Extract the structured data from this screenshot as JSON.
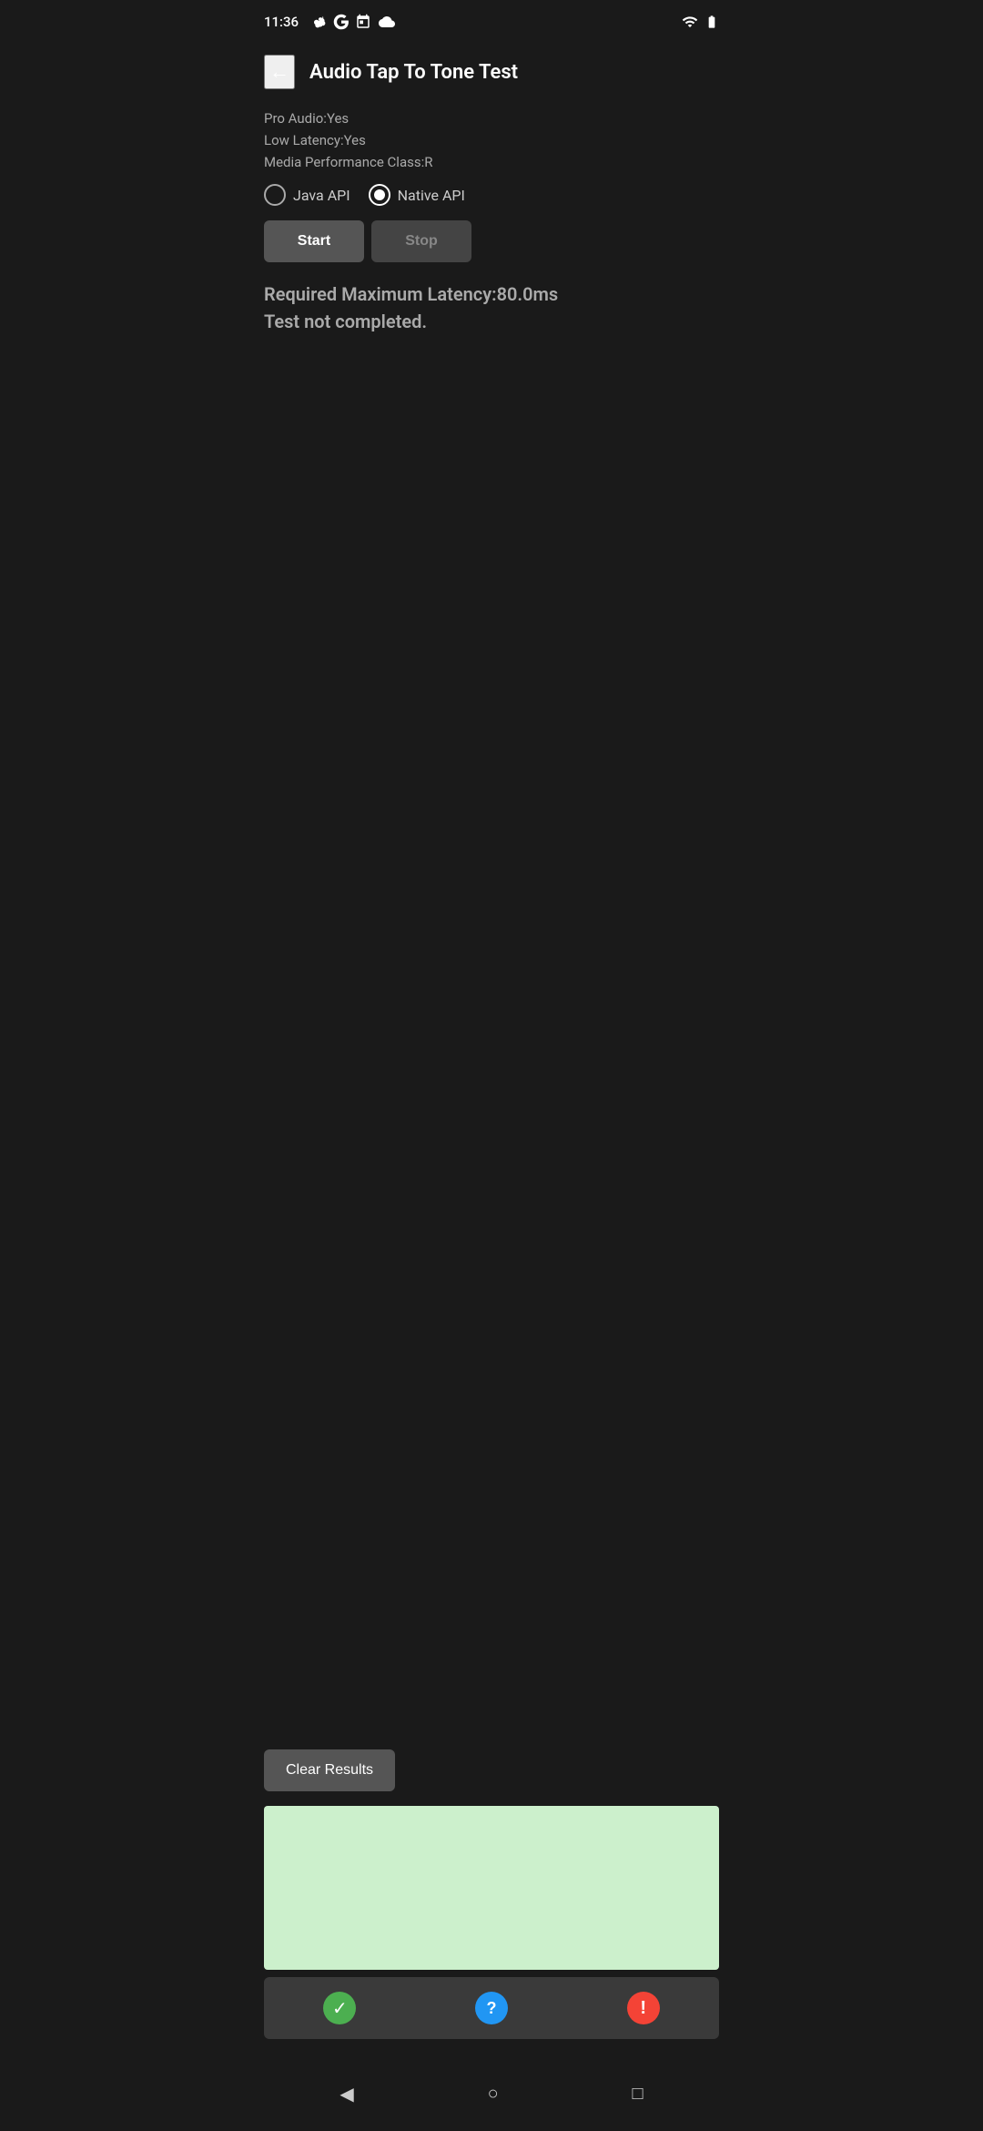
{
  "statusBar": {
    "time": "11:36",
    "iconsLeft": [
      "fan-icon",
      "google-icon",
      "calendar-icon",
      "cloud-icon"
    ],
    "iconsRight": [
      "wifi-icon",
      "battery-icon"
    ]
  },
  "header": {
    "backLabel": "←",
    "title": "Audio Tap To Tone Test"
  },
  "info": {
    "proAudio": "Pro Audio:Yes",
    "lowLatency": "Low Latency:Yes",
    "mediaPerf": "Media Performance Class:R"
  },
  "radioGroup": {
    "options": [
      {
        "id": "java",
        "label": "Java API",
        "selected": false
      },
      {
        "id": "native",
        "label": "Native API",
        "selected": true
      }
    ]
  },
  "buttons": {
    "start": "Start",
    "stop": "Stop"
  },
  "result": {
    "line1": "Required Maximum Latency:80.0ms",
    "line2": "Test not completed."
  },
  "clearResults": {
    "label": "Clear Results"
  },
  "bottomIcons": {
    "check": "✓",
    "question": "?",
    "exclamation": "!"
  },
  "navBar": {
    "back": "◀",
    "home": "○",
    "recent": "□"
  }
}
